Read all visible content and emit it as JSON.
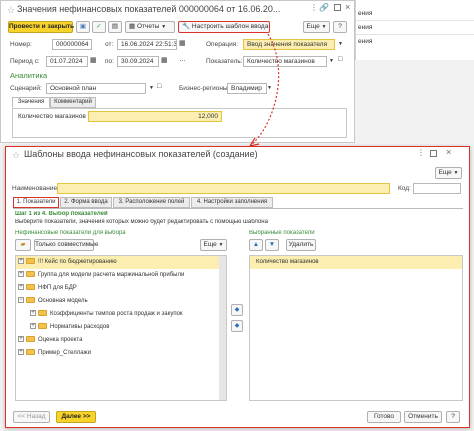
{
  "bg_window": {
    "title": "Значения нефинансовых показателей 000000064 от 16.06.20...",
    "post_close": "Провести и закрыть",
    "reports": "Отчеты",
    "settings_template": "Настроить шаблон ввода",
    "more": "Еще",
    "help": "?",
    "number_label": "Номер:",
    "number_value": "000000064",
    "from_label": "от:",
    "date_value": "16.06.2024 22:51:39",
    "operation_label": "Операция:",
    "operation_value": "Ввод значения показателя",
    "period_label": "Период с:",
    "period_from": "01.07.2024",
    "period_to_label": "по:",
    "period_to": "30.09.2024",
    "indicator_label": "Показатель:",
    "indicator_value": "Количество магазинов",
    "analytics_header": "Аналитика",
    "scenario_label": "Сценарий:",
    "scenario_value": "Основной план",
    "region_label": "Бизнес-регионы:",
    "region_value": "Владимир",
    "tab_values": "Значения",
    "tab_comment": "Комментарий",
    "row_label": "Количество магазинов",
    "row_value": "12,000"
  },
  "right_bg": {
    "rows": [
      "ения",
      "ения",
      "ения"
    ]
  },
  "dialog": {
    "title": "Шаблоны ввода нефинансовых показателей (создание)",
    "more": "Еще",
    "name_label": "Наименование:",
    "name_value": "",
    "code_label": "Код:",
    "code_value": "",
    "tabs": [
      "1. Показатели",
      "2. Форма ввода",
      "3. Расположение полей",
      "4. Настройки заполнения"
    ],
    "step_title": "Шаг 1 из 4. Выбор показателей",
    "step_desc": "Выберите показатели, значения которых можно будет редактировать с помощью шаблона",
    "left_header": "Нефинансовые показатели для выбора",
    "only_compatible": "Только совместимые",
    "left_more": "Еще",
    "tree": [
      "!!! Кейс по бюджетированию",
      "Группа для модели расчета маржинальной прибыли",
      "НФП для БДР",
      "Основная модель",
      "Коэффициенты темпов роста продаж и закупок",
      "Нормативы расходов",
      "Оценка проекта",
      "Пример_Стеллажи"
    ],
    "right_header": "Выбранные показатели",
    "delete": "Удалить",
    "selected": [
      "Количество магазинов"
    ],
    "back": "<< Назад",
    "next": "Далее >>",
    "done": "Готово",
    "cancel": "Отменить",
    "help": "?"
  },
  "colors": {
    "accent_yellow": "#f7d32c",
    "highlight_red": "#d9322b",
    "analytics_green": "#3a8c3a",
    "selected_row": "#fbeeb0"
  }
}
